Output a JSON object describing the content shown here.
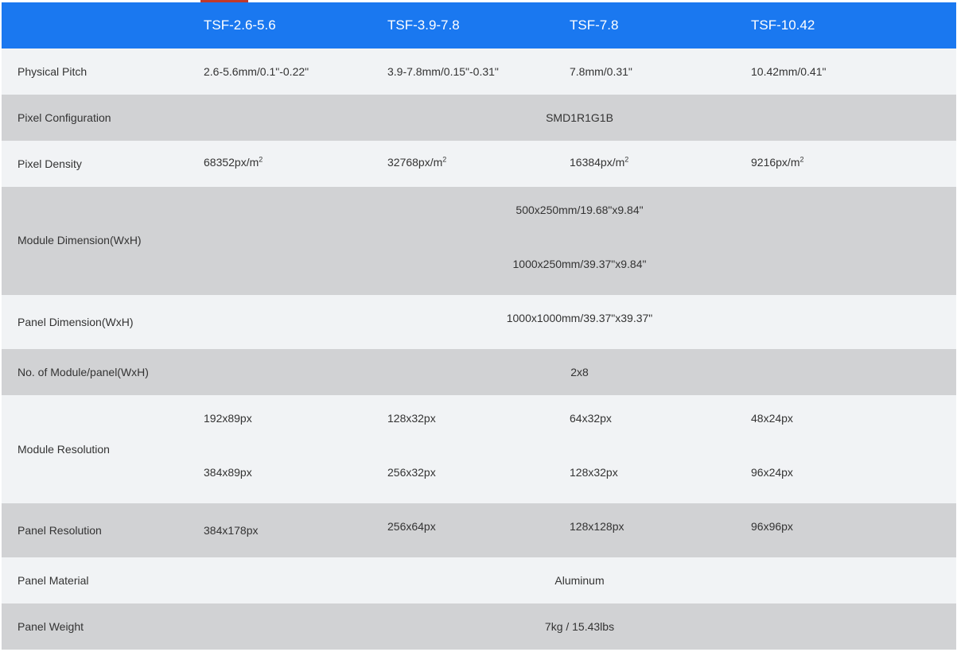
{
  "header": {
    "models": [
      "TSF-2.6-5.6",
      "TSF-3.9-7.8",
      "TSF-7.8",
      "TSF-10.42"
    ]
  },
  "rows": {
    "physical_pitch": {
      "label": "Physical Pitch",
      "values": [
        "2.6-5.6mm/0.1\"-0.22\"",
        "3.9-7.8mm/0.15\"-0.31\"",
        "7.8mm/0.31\"",
        "10.42mm/0.41\""
      ]
    },
    "pixel_configuration": {
      "label": "Pixel Configuration",
      "value": "SMD1R1G1B"
    },
    "pixel_density": {
      "label": "Pixel Density",
      "values": [
        "68352px/m",
        "32768px/m",
        "16384px/m",
        "9216px/m"
      ],
      "superscript": "2"
    },
    "module_dimension": {
      "label": "Module Dimension(WxH)",
      "values": [
        "500x250mm/19.68\"x9.84\"",
        "1000x250mm/39.37\"x9.84\""
      ]
    },
    "panel_dimension": {
      "label": "Panel Dimension(WxH)",
      "value": "1000x1000mm/39.37\"x39.37\""
    },
    "modules_per_panel": {
      "label": "No. of Module/panel(WxH)",
      "value": "2x8"
    },
    "module_resolution": {
      "label": "Module Resolution",
      "line1": [
        "192x89px",
        "128x32px",
        "64x32px",
        "48x24px"
      ],
      "line2": [
        "384x89px",
        "256x32px",
        "128x32px",
        "96x24px"
      ]
    },
    "panel_resolution": {
      "label": "Panel Resolution",
      "values": [
        "384x178px",
        "256x64px",
        "128x128px",
        "96x96px"
      ]
    },
    "panel_material": {
      "label": "Panel Material",
      "value": "Aluminum"
    },
    "panel_weight": {
      "label": "Panel Weight",
      "value": "7kg / 15.43lbs"
    }
  },
  "colors": {
    "header_bg": "#1a78f0",
    "row_light": "#f1f3f5",
    "row_dark": "#d1d2d4",
    "accent": "#c0392b"
  }
}
